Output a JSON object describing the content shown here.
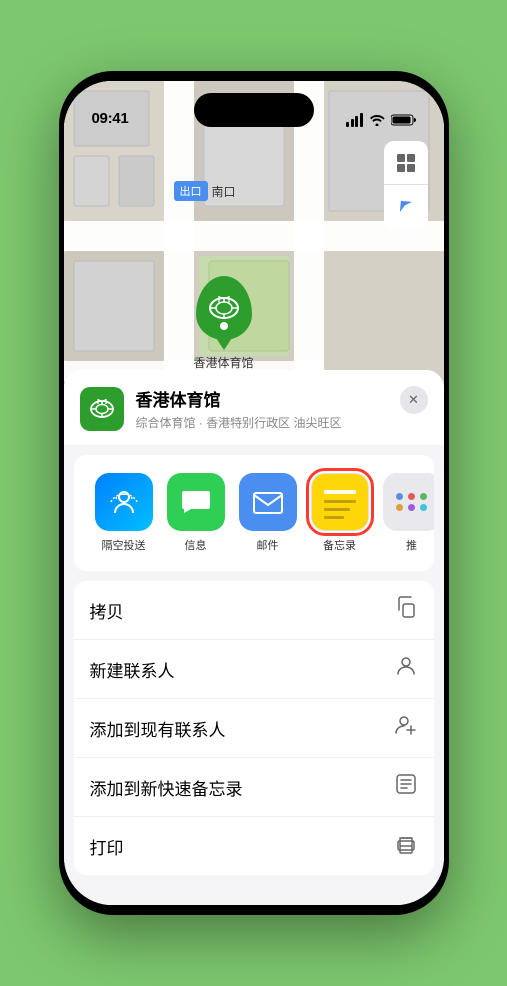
{
  "status_bar": {
    "time": "09:41",
    "location_icon": "▲"
  },
  "map": {
    "label_tag": "南口",
    "label_type": "出口"
  },
  "marker": {
    "name": "香港体育馆"
  },
  "location_header": {
    "name": "香港体育馆",
    "subtitle": "综合体育馆 · 香港特别行政区 油尖旺区",
    "close_label": "×"
  },
  "share_items": [
    {
      "id": "airdrop",
      "label": "隔空投送"
    },
    {
      "id": "messages",
      "label": "信息"
    },
    {
      "id": "mail",
      "label": "邮件"
    },
    {
      "id": "notes",
      "label": "备忘录"
    },
    {
      "id": "more",
      "label": "推"
    }
  ],
  "actions": [
    {
      "label": "拷贝",
      "icon": "copy"
    },
    {
      "label": "新建联系人",
      "icon": "person"
    },
    {
      "label": "添加到现有联系人",
      "icon": "person-add"
    },
    {
      "label": "添加到新快速备忘录",
      "icon": "note"
    },
    {
      "label": "打印",
      "icon": "print"
    }
  ]
}
